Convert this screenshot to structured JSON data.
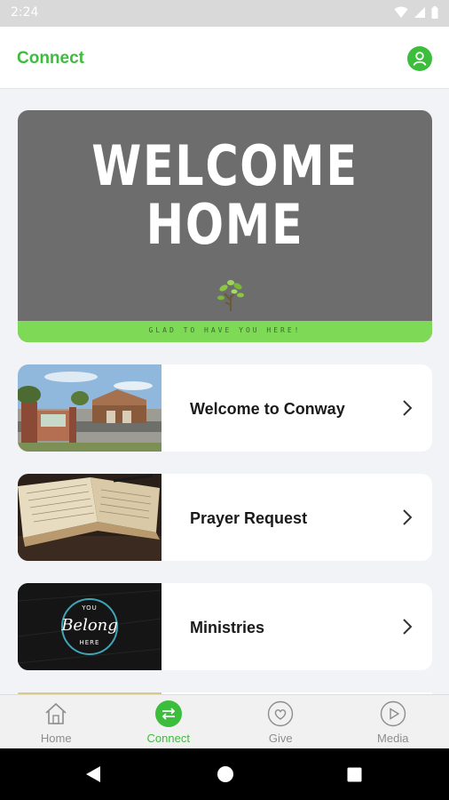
{
  "status": {
    "time": "2:24"
  },
  "header": {
    "title": "Connect"
  },
  "banner": {
    "line1": "WELCOME",
    "line2": "HOME",
    "tagline": "GLAD TO HAVE YOU HERE!"
  },
  "cards": [
    {
      "label": "Welcome to Conway"
    },
    {
      "label": "Prayer Request"
    },
    {
      "label": "Ministries",
      "thumb_text_top": "YOU",
      "thumb_text_mid": "Belong",
      "thumb_text_bottom": "HERE"
    }
  ],
  "bottom_nav": [
    {
      "label": "Home",
      "icon": "home-icon"
    },
    {
      "label": "Connect",
      "icon": "connect-icon"
    },
    {
      "label": "Give",
      "icon": "heart-icon"
    },
    {
      "label": "Media",
      "icon": "play-icon"
    }
  ],
  "colors": {
    "accent": "#3cbd3c",
    "banner_bg": "#6d6d6d",
    "banner_strip": "#7ed957"
  }
}
